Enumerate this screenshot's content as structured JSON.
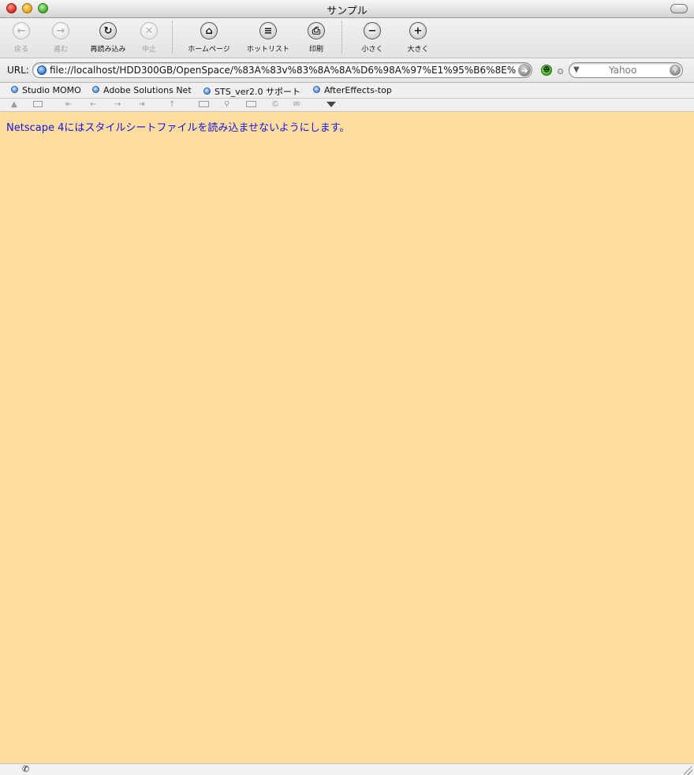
{
  "window": {
    "title": "サンプル"
  },
  "toolbar": {
    "back": "戻る",
    "forward": "進む",
    "reload": "再読み込み",
    "stop": "中止",
    "home": "ホームページ",
    "hotlist": "ホットリスト",
    "print": "印刷",
    "smaller": "小さく",
    "larger": "大きく"
  },
  "address": {
    "label": "URL:",
    "url": "file://localhost/HDD300GB/OpenSpace/%83A%83v%83%8A%8A%D6%98A%97%E1%95%B6%8E%",
    "search_placeholder": "Yahoo"
  },
  "bookmarks": [
    "Studio MOMO",
    "Adobe Solutions Net",
    "STS_ver2.0 サポート",
    "AfterEffects-top"
  ],
  "content": {
    "message": "Netscape 4にはスタイルシートファイルを読み込ませないようにします。"
  },
  "colors": {
    "page_background": "#ffdd9c",
    "content_text": "#1410e6"
  }
}
